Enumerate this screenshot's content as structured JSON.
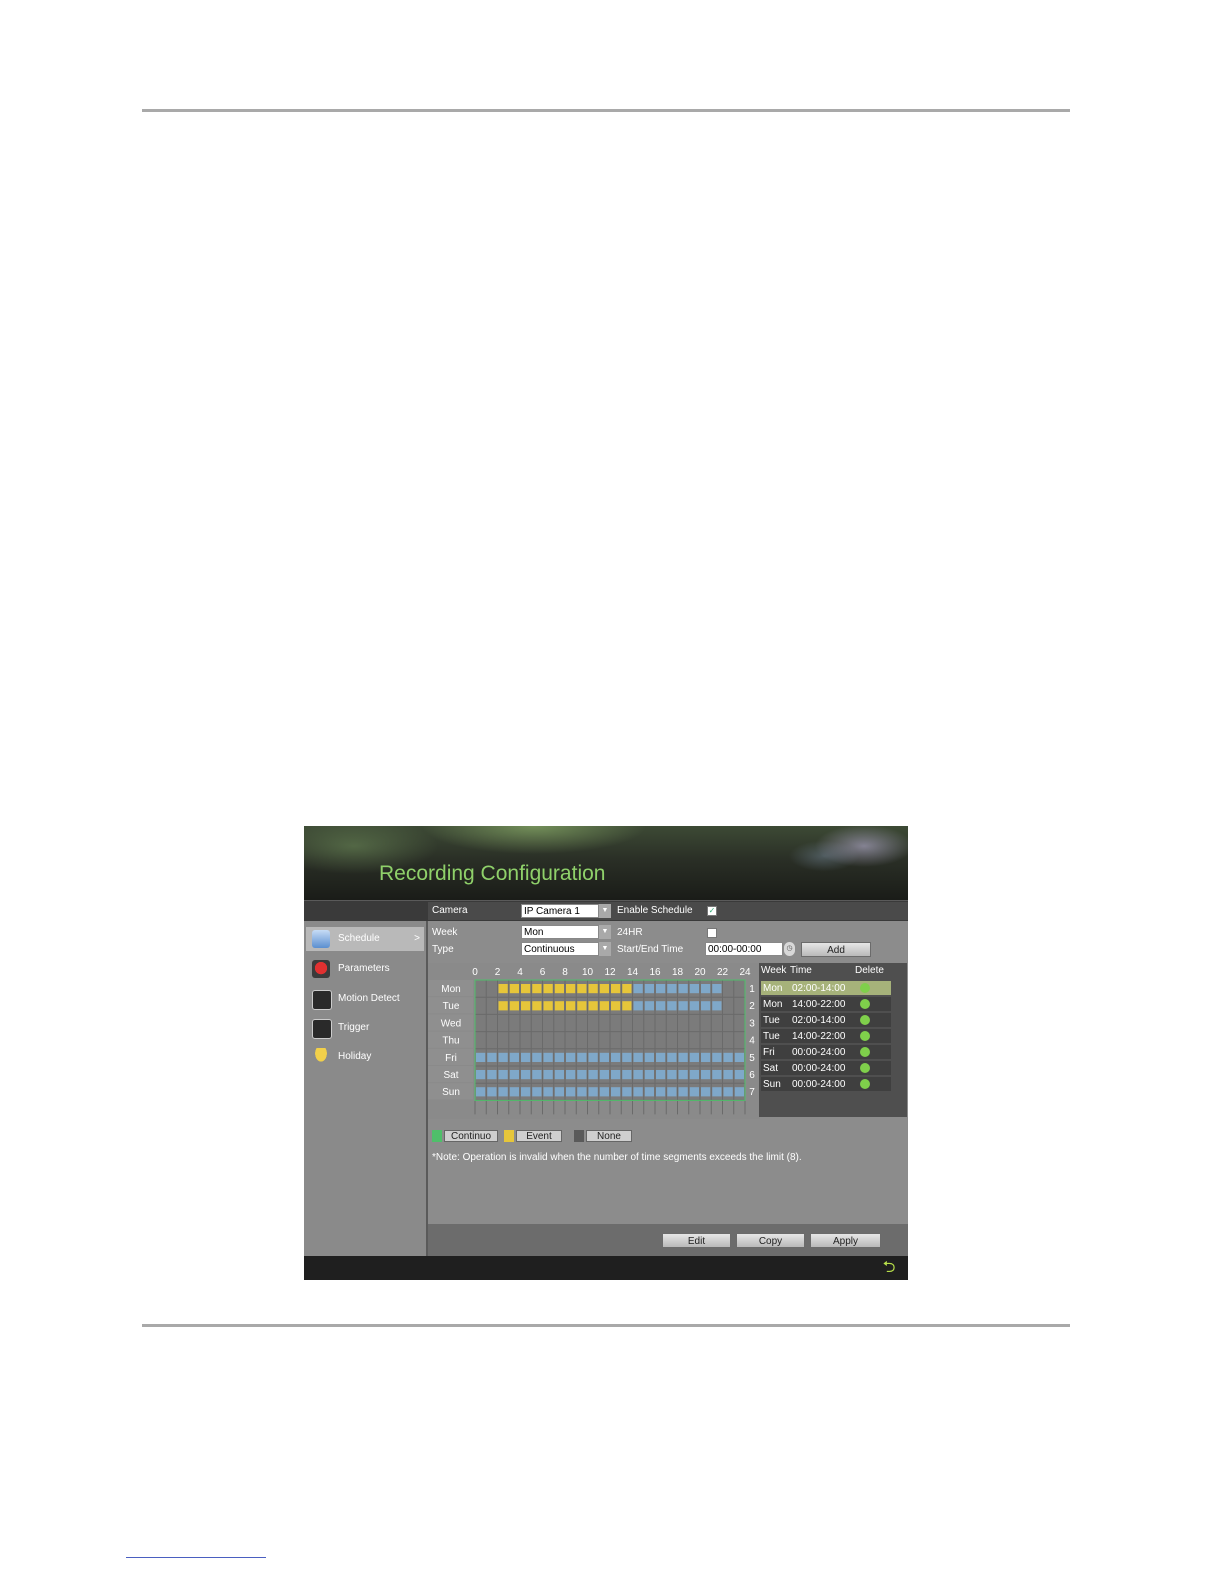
{
  "window": {
    "title": "Recording Configuration"
  },
  "sidebar": {
    "items": [
      {
        "label": "Schedule",
        "icon": "calendar-icon",
        "active": true,
        "arrow": ">"
      },
      {
        "label": "Parameters",
        "icon": "record-icon"
      },
      {
        "label": "Motion Detect",
        "icon": "motion-icon"
      },
      {
        "label": "Trigger",
        "icon": "trigger-icon"
      },
      {
        "label": "Holiday",
        "icon": "holiday-icon"
      }
    ]
  },
  "form": {
    "camera_label": "Camera",
    "camera_value": "IP Camera 1",
    "enable_schedule_label": "Enable Schedule",
    "enable_schedule_checked": true,
    "week_label": "Week",
    "week_value": "Mon",
    "hr24_label": "24HR",
    "hr24_checked": false,
    "type_label": "Type",
    "type_value": "Continuous",
    "start_end_label": "Start/End Time",
    "start_end_value": "00:00-00:00",
    "add_button": "Add"
  },
  "schedule": {
    "hour_labels": [
      "0",
      "2",
      "4",
      "6",
      "8",
      "10",
      "12",
      "14",
      "16",
      "18",
      "20",
      "22",
      "24"
    ],
    "days": [
      "Mon",
      "Tue",
      "Wed",
      "Thu",
      "Fri",
      "Sat",
      "Sun"
    ],
    "row_numbers": [
      "1",
      "2",
      "3",
      "4",
      "5",
      "6",
      "7"
    ],
    "colors": {
      "continuous": "#7fa8c9",
      "event": "#e6c63a",
      "none": "#777777"
    },
    "segments": [
      {
        "day": 0,
        "start": 2,
        "end": 14,
        "type": "event"
      },
      {
        "day": 0,
        "start": 14,
        "end": 22,
        "type": "continuous"
      },
      {
        "day": 1,
        "start": 2,
        "end": 14,
        "type": "event"
      },
      {
        "day": 1,
        "start": 14,
        "end": 22,
        "type": "continuous"
      },
      {
        "day": 4,
        "start": 0,
        "end": 24,
        "type": "continuous"
      },
      {
        "day": 5,
        "start": 0,
        "end": 24,
        "type": "continuous"
      },
      {
        "day": 6,
        "start": 0,
        "end": 24,
        "type": "continuous"
      }
    ]
  },
  "list": {
    "headers": {
      "week": "Week",
      "time": "Time",
      "delete": "Delete"
    },
    "rows": [
      {
        "week": "Mon",
        "time": "02:00-14:00",
        "selected": true
      },
      {
        "week": "Mon",
        "time": "14:00-22:00"
      },
      {
        "week": "Tue",
        "time": "02:00-14:00"
      },
      {
        "week": "Tue",
        "time": "14:00-22:00"
      },
      {
        "week": "Fri",
        "time": "00:00-24:00"
      },
      {
        "week": "Sat",
        "time": "00:00-24:00"
      },
      {
        "week": "Sun",
        "time": "00:00-24:00"
      }
    ]
  },
  "legend": {
    "continuous": "Continuo",
    "event": "Event",
    "none": "None",
    "colors": {
      "continuous": "#4fbf6a",
      "event": "#e6c63a",
      "none": "#5a5a5a"
    }
  },
  "note": "*Note: Operation is invalid when the number of time segments exceeds the limit (8).",
  "buttons": {
    "edit": "Edit",
    "copy": "Copy",
    "apply": "Apply"
  }
}
